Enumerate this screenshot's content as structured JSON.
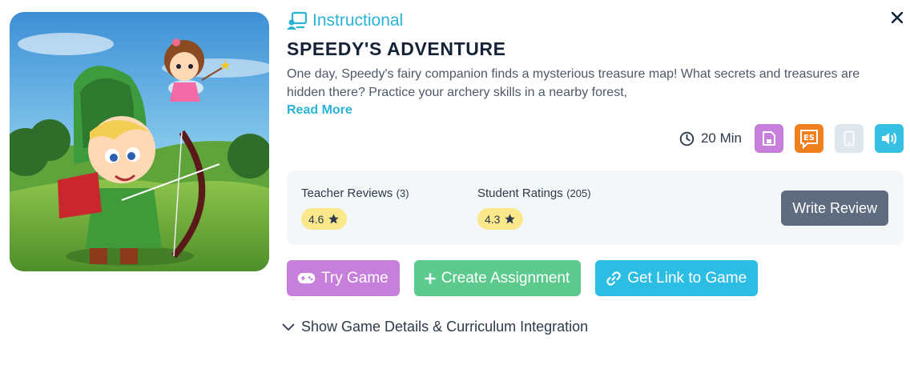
{
  "game": {
    "category": "Instructional",
    "title": "SPEEDY'S ADVENTURE",
    "description": "One day, Speedy's fairy companion finds a mysterious treasure map! What secrets and treasures are hidden there? Practice your archery skills in a nearby forest,",
    "read_more": "Read More",
    "duration": "20 Min",
    "feature_icons": [
      "save-icon",
      "spanish-es-icon",
      "mobile-icon",
      "audio-icon"
    ],
    "thumbnail_icon": "archer-and-fairy-illustration"
  },
  "reviews": {
    "teacher": {
      "label": "Teacher Reviews",
      "count": "(3)",
      "rating": "4.6"
    },
    "student": {
      "label": "Student Ratings",
      "count": "(205)",
      "rating": "4.3"
    },
    "write_review": "Write Review"
  },
  "actions": {
    "try_game": "Try Game",
    "create_assignment": "Create Assignment",
    "get_link": "Get Link to Game"
  },
  "details_toggle": "Show Game Details & Curriculum Integration",
  "colors": {
    "accent": "#2bb3d6",
    "try_game": "#c77fdc",
    "create_assignment": "#5cc98d",
    "get_link": "#2bbde3",
    "write_review": "#5f6b7f",
    "rating_pill": "#fbe88a",
    "es_badge": "#f07f1e"
  }
}
